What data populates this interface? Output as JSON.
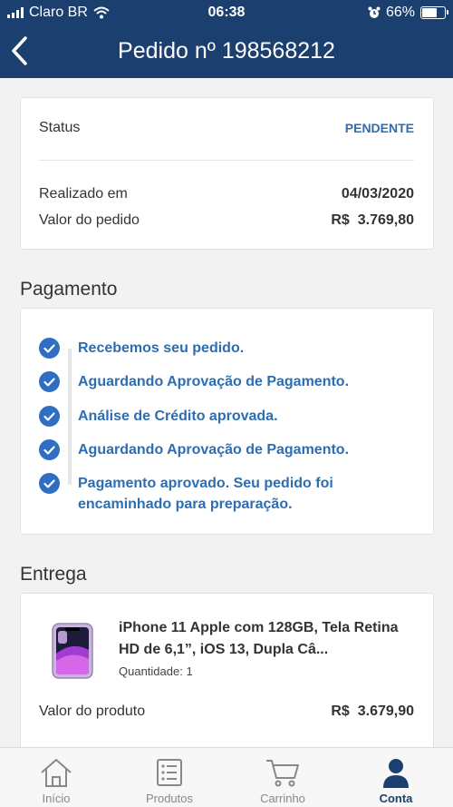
{
  "statusbar": {
    "carrier": "Claro BR",
    "time": "06:38",
    "battery": "66%",
    "battery_level": 0.66
  },
  "header": {
    "title": "Pedido nº 198568212",
    "back_icon": "chevron-left-icon"
  },
  "summary": {
    "status_label": "Status",
    "status_value": "PENDENTE",
    "date_label": "Realizado em",
    "date_value": "04/03/2020",
    "total_label": "Valor do pedido",
    "total_value": "R$  3.769,80"
  },
  "payment": {
    "title": "Pagamento",
    "steps": [
      "Recebemos seu pedido.",
      "Aguardando Aprovação de Pagamento.",
      "Análise de Crédito aprovada.",
      "Aguardando Aprovação de Pagamento.",
      "Pagamento aprovado. Seu pedido foi encaminhado para preparação."
    ]
  },
  "delivery": {
    "title": "Entrega",
    "product_name": "iPhone 11 Apple com 128GB, Tela Retina HD de 6,1”, iOS 13, Dupla Câ...",
    "quantity": "Quantidade: 1",
    "price_label": "Valor do produto",
    "price_value": "R$  3.679,90"
  },
  "tabs": [
    {
      "label": "Início",
      "icon": "home-icon"
    },
    {
      "label": "Produtos",
      "icon": "list-icon"
    },
    {
      "label": "Carrinho",
      "icon": "cart-icon"
    },
    {
      "label": "Conta",
      "icon": "user-icon",
      "active": true
    }
  ],
  "colors": {
    "header": "#1b3f6e",
    "accent": "#2d6db1",
    "check": "#2f6ec0",
    "background": "#f2f2f2"
  }
}
